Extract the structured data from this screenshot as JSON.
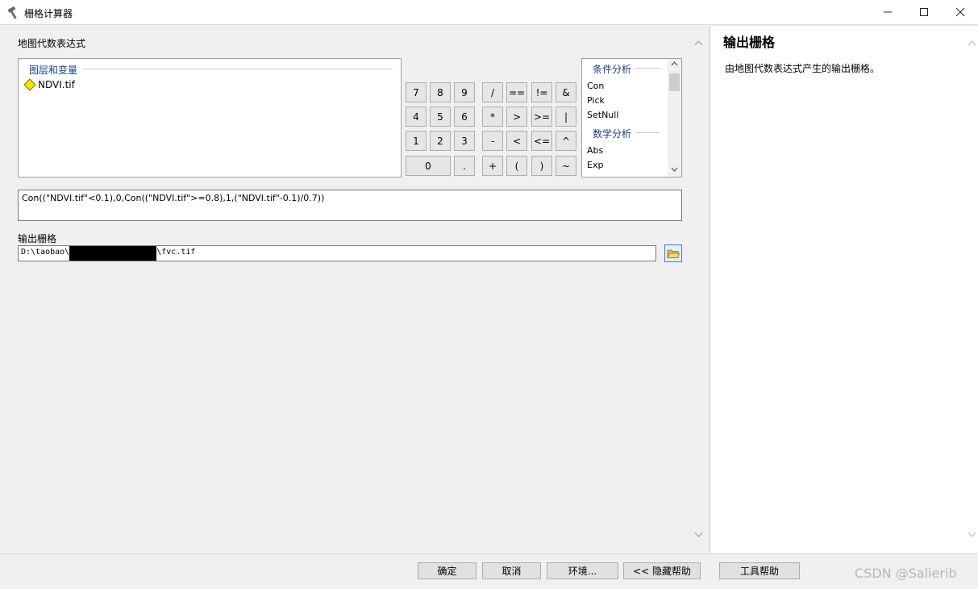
{
  "window": {
    "title": "栅格计算器"
  },
  "left": {
    "section_label": "地图代数表达式",
    "layers_header": "图层和变量",
    "layers": [
      "NDVI.tif"
    ],
    "calc_buttons": [
      "7",
      "8",
      "9",
      "/",
      "==",
      "!=",
      "&",
      "4",
      "5",
      "6",
      "*",
      ">",
      ">=",
      "|",
      "1",
      "2",
      "3",
      "-",
      "<",
      "<=",
      "^",
      "0",
      ".",
      "+",
      "(",
      ")",
      "~"
    ],
    "functions": {
      "group1": "条件分析",
      "group1_items": [
        "Con",
        "Pick",
        "SetNull"
      ],
      "group2": "数学分析",
      "group2_items": [
        "Abs",
        "Exp"
      ]
    },
    "expression": "Con((\"NDVI.tif\"<0.1),0,Con((\"NDVI.tif\">=0.8),1,(\"NDVI.tif\"-0.1)/0.7))",
    "output_label": "输出栅格",
    "output_path_prefix": "D:\\taobao\\",
    "output_path_suffix": "\\fvc.tif"
  },
  "help": {
    "title": "输出栅格",
    "text": "由地图代数表达式产生的输出栅格。"
  },
  "buttons": {
    "ok": "确定",
    "cancel": "取消",
    "env": "环境...",
    "hide_help": "<< 隐藏帮助",
    "tool_help": "工具帮助"
  },
  "watermark": "CSDN @Salierib"
}
